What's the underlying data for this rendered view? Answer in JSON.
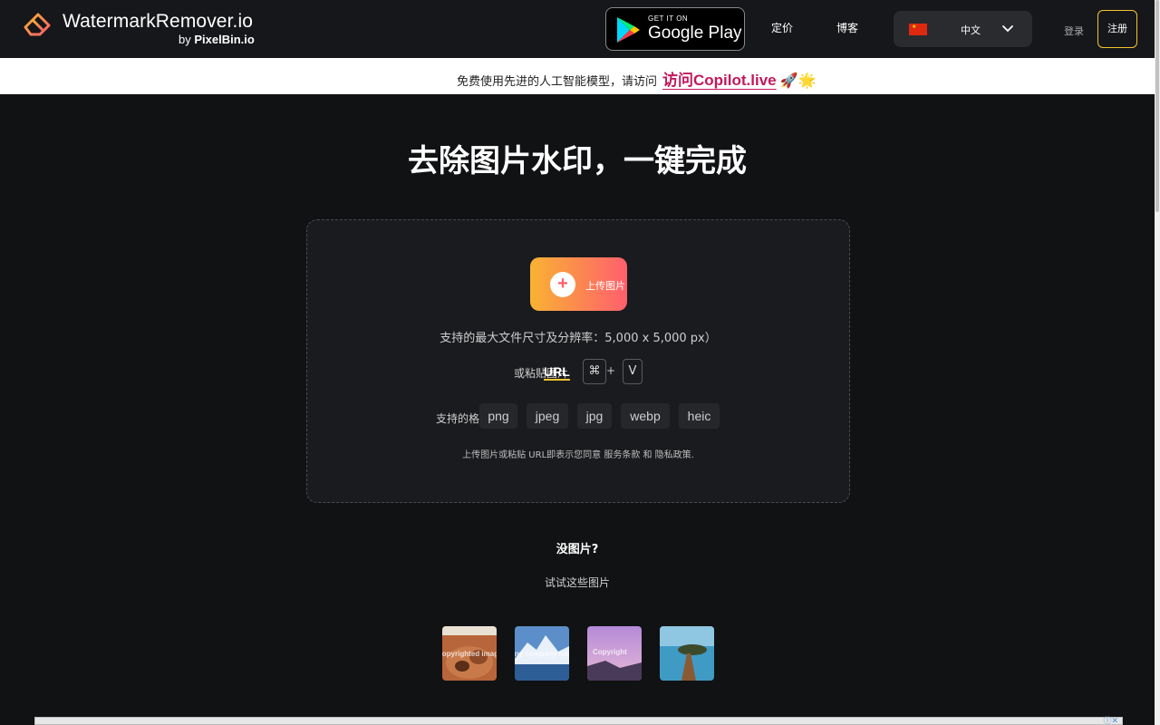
{
  "header": {
    "logo_text": "WatermarkRemover.io",
    "logo_sub_prefix": "by",
    "logo_sub_brand": "PixelBin.io",
    "google_play_small": "GET IT ON",
    "google_play_big": "Google Play",
    "nav": [
      "定价",
      "博客"
    ],
    "language": {
      "flag": "china-flag-icon",
      "label": "中文"
    },
    "login": "登录",
    "signup": "注册"
  },
  "banner": {
    "text": "免费使用先进的人工智能模型，请访问",
    "link": "访问Copilot.live",
    "emoji": "🚀🌟"
  },
  "main": {
    "title": "去除图片水印，一键完成",
    "upload_label": "上传图片",
    "limit_text": "支持的最大文件尺寸及分辨率：5,000 x 5,000 px）",
    "paste_prefix": "或粘贴图片",
    "url_label": "URL",
    "shortcut_cmd": "⌘",
    "shortcut_plus": "+",
    "shortcut_key": "V",
    "formats_label": "支持的格式:",
    "formats": [
      "png",
      "jpeg",
      "jpg",
      "webp",
      "heic"
    ],
    "terms": "上传图片或粘贴 URL即表示您同意 服务条款 和 隐私政策."
  },
  "samples": {
    "heading": "没图片?",
    "subheading": "试试这些图片",
    "watermarks": [
      "Copyrighted image",
      "Any company name",
      "Copyright",
      ""
    ]
  },
  "colors": {
    "accent_yellow": "#f4c430",
    "gradient_start": "#f9b233",
    "gradient_end": "#ff5f6d",
    "banner_link": "#c2185b",
    "background": "#111214"
  }
}
